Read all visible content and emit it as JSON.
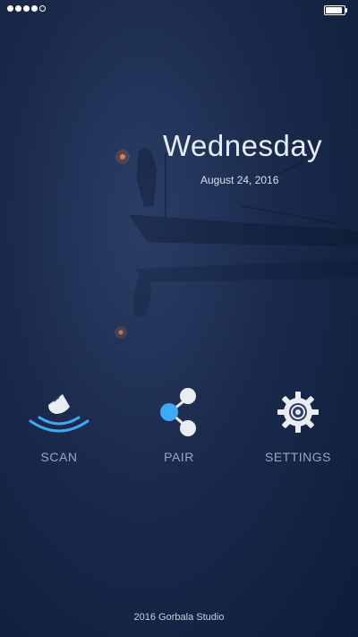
{
  "status_bar": {
    "signal_dots": 4,
    "battery_level": 1.0
  },
  "header": {
    "day": "Wednesday",
    "date": "August 24, 2016"
  },
  "actions": [
    {
      "label": "SCAN",
      "icon": "scan-buoy-icon"
    },
    {
      "label": "PAIR",
      "icon": "share-nodes-icon"
    },
    {
      "label": "SETTINGS",
      "icon": "gear-icon"
    }
  ],
  "footer": {
    "credit": "2016 Gorbala Studio"
  },
  "colors": {
    "accent_blue": "#3fa9f5",
    "icon_light": "#e9ecf2",
    "label": "#9aa6c0"
  }
}
